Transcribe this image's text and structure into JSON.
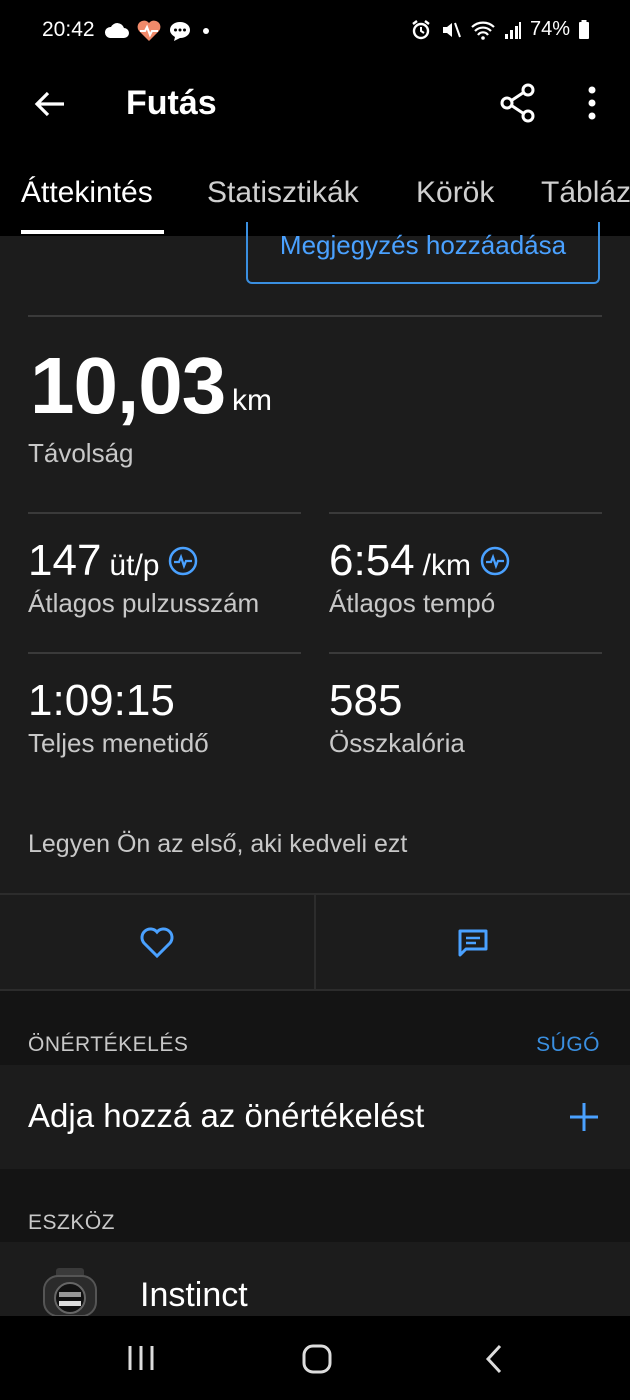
{
  "status_bar": {
    "time": "20:42",
    "battery": "74%",
    "left_icons": [
      "cloud-icon",
      "heart-rate-icon",
      "message-icon",
      "dot-icon"
    ],
    "right_icons": [
      "alarm-icon",
      "mute-icon",
      "wifi-icon",
      "signal-icon",
      "battery-icon"
    ]
  },
  "app_bar": {
    "title": "Futás"
  },
  "tabs": [
    {
      "label": "Áttekintés",
      "active": true
    },
    {
      "label": "Statisztikák",
      "active": false
    },
    {
      "label": "Körök",
      "active": false
    },
    {
      "label": "Tábláz",
      "active": false
    }
  ],
  "note_button": "Megjegyzés hozzáadása",
  "distance": {
    "value": "10,03",
    "unit": "km",
    "label": "Távolság"
  },
  "stats": [
    {
      "value": "147",
      "unit": "üt/p",
      "label": "Átlagos pulzusszám",
      "icon": "heartbeat-icon"
    },
    {
      "value": "6:54",
      "unit": "/km",
      "label": "Átlagos tempó",
      "icon": "heartbeat-icon"
    },
    {
      "value": "1:09:15",
      "unit": "",
      "label": "Teljes menetidő"
    },
    {
      "value": "585",
      "unit": "",
      "label": "Összkalória"
    }
  ],
  "likes_text": "Legyen Ön az első, aki kedveli ezt",
  "self_eval": {
    "heading": "ÖNÉRTÉKELÉS",
    "help": "SÚGÓ",
    "add_label": "Adja hozzá az önértékelést"
  },
  "device": {
    "heading": "ESZKÖZ",
    "name": "Instinct"
  },
  "colors": {
    "accent": "#4aa1ff",
    "background": "#1c1c1c",
    "bar": "#000000"
  }
}
